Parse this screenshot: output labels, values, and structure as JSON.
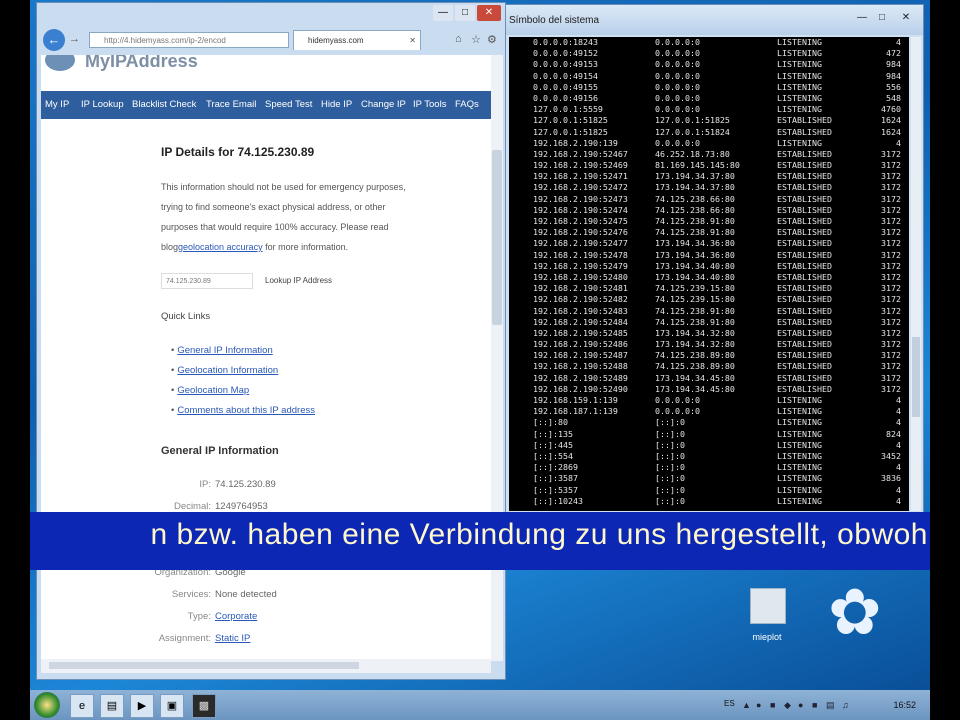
{
  "console": {
    "title": "Símbolo del sistema",
    "rows": [
      [
        "0.0.0.0:18243",
        "0.0.0.0:0",
        "LISTENING",
        "4"
      ],
      [
        "0.0.0.0:49152",
        "0.0.0.0:0",
        "LISTENING",
        "472"
      ],
      [
        "0.0.0.0:49153",
        "0.0.0.0:0",
        "LISTENING",
        "984"
      ],
      [
        "0.0.0.0:49154",
        "0.0.0.0:0",
        "LISTENING",
        "984"
      ],
      [
        "0.0.0.0:49155",
        "0.0.0.0:0",
        "LISTENING",
        "556"
      ],
      [
        "0.0.0.0:49156",
        "0.0.0.0:0",
        "LISTENING",
        "548"
      ],
      [
        "127.0.0.1:5559",
        "0.0.0.0:0",
        "LISTENING",
        "4760"
      ],
      [
        "127.0.0.1:51825",
        "127.0.0.1:51825",
        "ESTABLISHED",
        "1624"
      ],
      [
        "127.0.0.1:51825",
        "127.0.0.1:51824",
        "ESTABLISHED",
        "1624"
      ],
      [
        "192.168.2.190:139",
        "0.0.0.0:0",
        "LISTENING",
        "4"
      ],
      [
        "192.168.2.190:52467",
        "46.252.18.73:80",
        "ESTABLISHED",
        "3172"
      ],
      [
        "192.168.2.190:52469",
        "81.169.145.145:80",
        "ESTABLISHED",
        "3172"
      ],
      [
        "192.168.2.190:52471",
        "173.194.34.37:80",
        "ESTABLISHED",
        "3172"
      ],
      [
        "192.168.2.190:52472",
        "173.194.34.37:80",
        "ESTABLISHED",
        "3172"
      ],
      [
        "192.168.2.190:52473",
        "74.125.238.66:80",
        "ESTABLISHED",
        "3172"
      ],
      [
        "192.168.2.190:52474",
        "74.125.238.66:80",
        "ESTABLISHED",
        "3172"
      ],
      [
        "192.168.2.190:52475",
        "74.125.238.91:80",
        "ESTABLISHED",
        "3172"
      ],
      [
        "192.168.2.190:52476",
        "74.125.238.91:80",
        "ESTABLISHED",
        "3172"
      ],
      [
        "192.168.2.190:52477",
        "173.194.34.36:80",
        "ESTABLISHED",
        "3172"
      ],
      [
        "192.168.2.190:52478",
        "173.194.34.36:80",
        "ESTABLISHED",
        "3172"
      ],
      [
        "192.168.2.190:52479",
        "173.194.34.40:80",
        "ESTABLISHED",
        "3172"
      ],
      [
        "192.168.2.190:52480",
        "173.194.34.40:80",
        "ESTABLISHED",
        "3172"
      ],
      [
        "192.168.2.190:52481",
        "74.125.239.15:80",
        "ESTABLISHED",
        "3172"
      ],
      [
        "192.168.2.190:52482",
        "74.125.239.15:80",
        "ESTABLISHED",
        "3172"
      ],
      [
        "192.168.2.190:52483",
        "74.125.238.91:80",
        "ESTABLISHED",
        "3172"
      ],
      [
        "192.168.2.190:52484",
        "74.125.238.91:80",
        "ESTABLISHED",
        "3172"
      ],
      [
        "192.168.2.190:52485",
        "173.194.34.32:80",
        "ESTABLISHED",
        "3172"
      ],
      [
        "192.168.2.190:52486",
        "173.194.34.32:80",
        "ESTABLISHED",
        "3172"
      ],
      [
        "192.168.2.190:52487",
        "74.125.238.89:80",
        "ESTABLISHED",
        "3172"
      ],
      [
        "192.168.2.190:52488",
        "74.125.238.89:80",
        "ESTABLISHED",
        "3172"
      ],
      [
        "192.168.2.190:52489",
        "173.194.34.45:80",
        "ESTABLISHED",
        "3172"
      ],
      [
        "192.168.2.190:52490",
        "173.194.34.45:80",
        "ESTABLISHED",
        "3172"
      ],
      [
        "192.168.159.1:139",
        "0.0.0.0:0",
        "LISTENING",
        "4"
      ],
      [
        "192.168.187.1:139",
        "0.0.0.0:0",
        "LISTENING",
        "4"
      ],
      [
        "[::]:80",
        "[::]:0",
        "LISTENING",
        "4"
      ],
      [
        "[::]:135",
        "[::]:0",
        "LISTENING",
        "824"
      ],
      [
        "[::]:445",
        "[::]:0",
        "LISTENING",
        "4"
      ],
      [
        "[::]:554",
        "[::]:0",
        "LISTENING",
        "3452"
      ],
      [
        "[::]:2869",
        "[::]:0",
        "LISTENING",
        "4"
      ],
      [
        "[::]:3587",
        "[::]:0",
        "LISTENING",
        "3836"
      ],
      [
        "[::]:5357",
        "[::]:0",
        "LISTENING",
        "4"
      ],
      [
        "[::]:10243",
        "[::]:0",
        "LISTENING",
        "4"
      ]
    ]
  },
  "browser": {
    "address": "http://4.hidemyass.com/ip-2/encod",
    "tab_title": "hidemyass.com",
    "logo": "MyIPAddress",
    "menu": [
      "My IP",
      "IP Lookup",
      "Blacklist Check",
      "Trace Email",
      "Speed Test",
      "Hide IP",
      "Change IP",
      "IP Tools",
      "FAQs"
    ],
    "heading": "IP Details for 74.125.230.89",
    "para_lines": [
      "This information should not be used for emergency purposes,",
      "trying to find someone's exact physical address, or other",
      "purposes that would require 100% accuracy. Please read"
    ],
    "para_prefix": "blog",
    "para_link": "geolocation accuracy",
    "para_suffix": " for more information.",
    "lookup_value": "74.125.230.89",
    "lookup_button": "Lookup IP Address",
    "quick_links_title": "Quick Links",
    "quick_links": [
      "General IP Information",
      "Geolocation Information",
      "Geolocation Map",
      "Comments about this IP address"
    ],
    "general_title": "General IP Information",
    "general_rows": [
      {
        "k": "IP:",
        "v": "74.125.230.89",
        "link": false
      },
      {
        "k": "Decimal:",
        "v": "1249764953",
        "link": false
      },
      {
        "k": "Organization:",
        "v": "Google",
        "link": false
      },
      {
        "k": "Services:",
        "v": "None detected",
        "link": false
      },
      {
        "k": "Type:",
        "v": "Corporate",
        "link": true
      },
      {
        "k": "Assignment:",
        "v": "Static IP",
        "link": true
      }
    ]
  },
  "subtitle": "n bzw. haben eine Verbindung zu uns hergestellt, obwoh",
  "desktop_icon_label": "mieplot",
  "taskbar": {
    "lang": "ES",
    "clock": "16:52"
  }
}
